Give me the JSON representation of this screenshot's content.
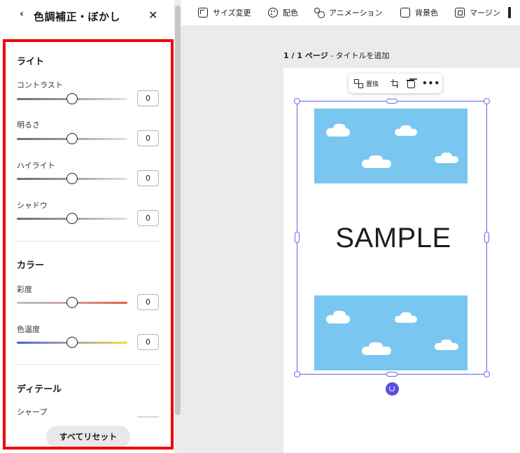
{
  "panel": {
    "title": "色調補正・ぼかし",
    "back_icon": "chevron-left-icon",
    "close_icon": "close-icon",
    "back_glyph": "‹",
    "close_glyph": "✕",
    "sections": {
      "light": {
        "title": "ライト",
        "sliders": [
          {
            "label": "コントラスト",
            "value": "0",
            "position": 0.5
          },
          {
            "label": "明るさ",
            "value": "0",
            "position": 0.5
          },
          {
            "label": "ハイライト",
            "value": "0",
            "position": 0.5
          },
          {
            "label": "シャドウ",
            "value": "0",
            "position": 0.5
          }
        ]
      },
      "color": {
        "title": "カラー",
        "sliders": [
          {
            "label": "彩度",
            "value": "0",
            "position": 0.5
          },
          {
            "label": "色温度",
            "value": "0",
            "position": 0.5
          }
        ]
      },
      "detail": {
        "title": "ディテール",
        "sliders": [
          {
            "label": "シャープ",
            "value": "",
            "position": 0.5
          }
        ]
      }
    },
    "reset_label": "すべてリセット",
    "highlight_color": "#ee0000"
  },
  "toolbar": {
    "items": [
      {
        "label": "サイズ変更",
        "icon": "resize-icon"
      },
      {
        "label": "配色",
        "icon": "palette-icon"
      },
      {
        "label": "アニメーション",
        "icon": "animation-icon"
      },
      {
        "label": "背景色",
        "icon": "background-color-icon"
      },
      {
        "label": "マージン",
        "icon": "margin-icon"
      }
    ]
  },
  "canvas": {
    "page_counter": "1 / 1 ページ",
    "page_title_placeholder": " - タイトルを追加",
    "float_toolbar": {
      "replace_label": "置換",
      "replace_icon": "replace-icon",
      "crop_icon": "crop-icon",
      "delete_icon": "trash-icon",
      "more_icon": "more-icon",
      "more_glyph": "•••"
    },
    "sample_text": "SAMPLE",
    "selection_color": "#6a5ff2",
    "sky_color": "#79c6f0",
    "rotate_icon": "rotate-icon"
  }
}
